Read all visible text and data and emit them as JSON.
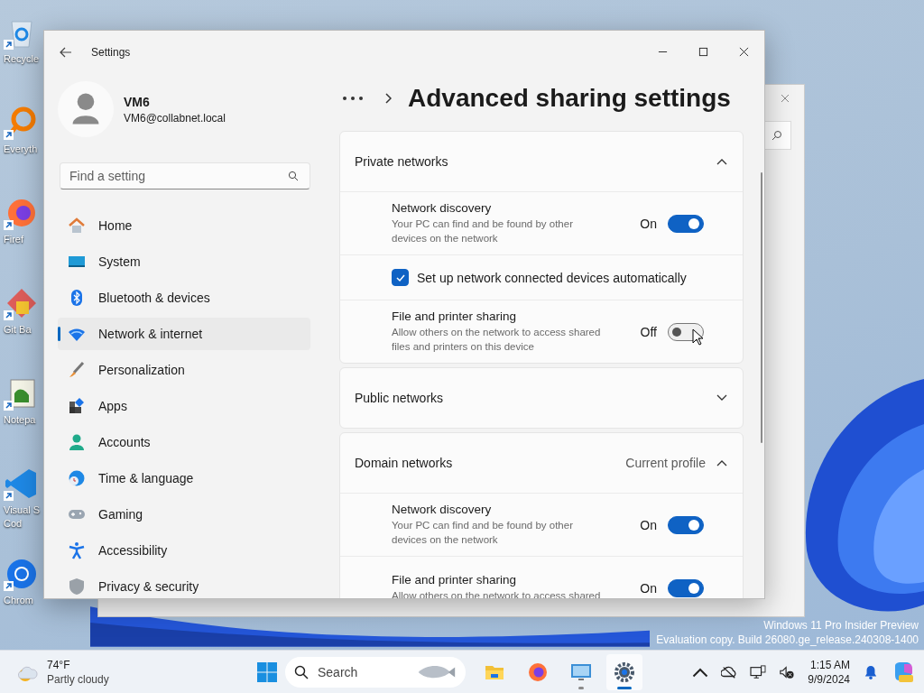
{
  "desktop": {
    "icons": [
      {
        "kind": "recycle",
        "label": "Recycle"
      },
      {
        "kind": "everything",
        "label": "Everyth"
      },
      {
        "kind": "firefox",
        "label": "Firef"
      },
      {
        "kind": "git",
        "label": "Git Ba"
      },
      {
        "kind": "notepad",
        "label": "Notepa"
      },
      {
        "kind": "vscode",
        "label": "Visual S\nCod"
      },
      {
        "kind": "chrome",
        "label": "Chrom"
      }
    ],
    "watermark": [
      "Windows 11 Pro Insider Preview",
      "Evaluation copy. Build 26080.ge_release.240308-1400"
    ]
  },
  "window": {
    "title": "Settings"
  },
  "account": {
    "name": "VM6",
    "email": "VM6@collabnet.local"
  },
  "search": {
    "placeholder": "Find a setting"
  },
  "sidebar": {
    "items": [
      {
        "label": "Home",
        "selected": false
      },
      {
        "label": "System",
        "selected": false
      },
      {
        "label": "Bluetooth & devices",
        "selected": false
      },
      {
        "label": "Network & internet",
        "selected": true
      },
      {
        "label": "Personalization",
        "selected": false
      },
      {
        "label": "Apps",
        "selected": false
      },
      {
        "label": "Accounts",
        "selected": false
      },
      {
        "label": "Time & language",
        "selected": false
      },
      {
        "label": "Gaming",
        "selected": false
      },
      {
        "label": "Accessibility",
        "selected": false
      },
      {
        "label": "Privacy & security",
        "selected": false
      }
    ]
  },
  "page_title": "Advanced sharing settings",
  "sections": [
    {
      "title": "Private networks",
      "expanded": true,
      "rows": [
        {
          "kind": "toggle",
          "title": "Network discovery",
          "description": "Your PC can find and be found by other devices on the network",
          "state_label": "On",
          "on": true
        },
        {
          "kind": "checkbox",
          "label": "Set up network connected devices automatically",
          "checked": true
        },
        {
          "kind": "toggle",
          "title": "File and printer sharing",
          "description": "Allow others on the network to access shared files and printers on this device",
          "state_label": "Off",
          "on": false
        }
      ]
    },
    {
      "title": "Public networks",
      "expanded": false
    },
    {
      "title": "Domain networks",
      "status": "Current profile",
      "expanded": true,
      "rows": [
        {
          "kind": "toggle",
          "title": "Network discovery",
          "description": "Your PC can find and be found by other devices on the network",
          "state_label": "On",
          "on": true
        },
        {
          "kind": "toggle",
          "title": "File and printer sharing",
          "description": "Allow others on the network to access shared",
          "state_label": "On",
          "on": true
        }
      ]
    }
  ],
  "taskbar": {
    "weather": {
      "temperature": "74°F",
      "condition": "Partly cloudy"
    },
    "search": {
      "placeholder": "Search"
    },
    "apps": [
      {
        "kind": "folder",
        "running": false,
        "selected": false
      },
      {
        "kind": "firefox",
        "running": false,
        "selected": false
      },
      {
        "kind": "remote",
        "running": true,
        "selected": false
      },
      {
        "kind": "settings",
        "running": true,
        "selected": true
      }
    ],
    "time": "1:15 AM",
    "date": "9/9/2024"
  }
}
